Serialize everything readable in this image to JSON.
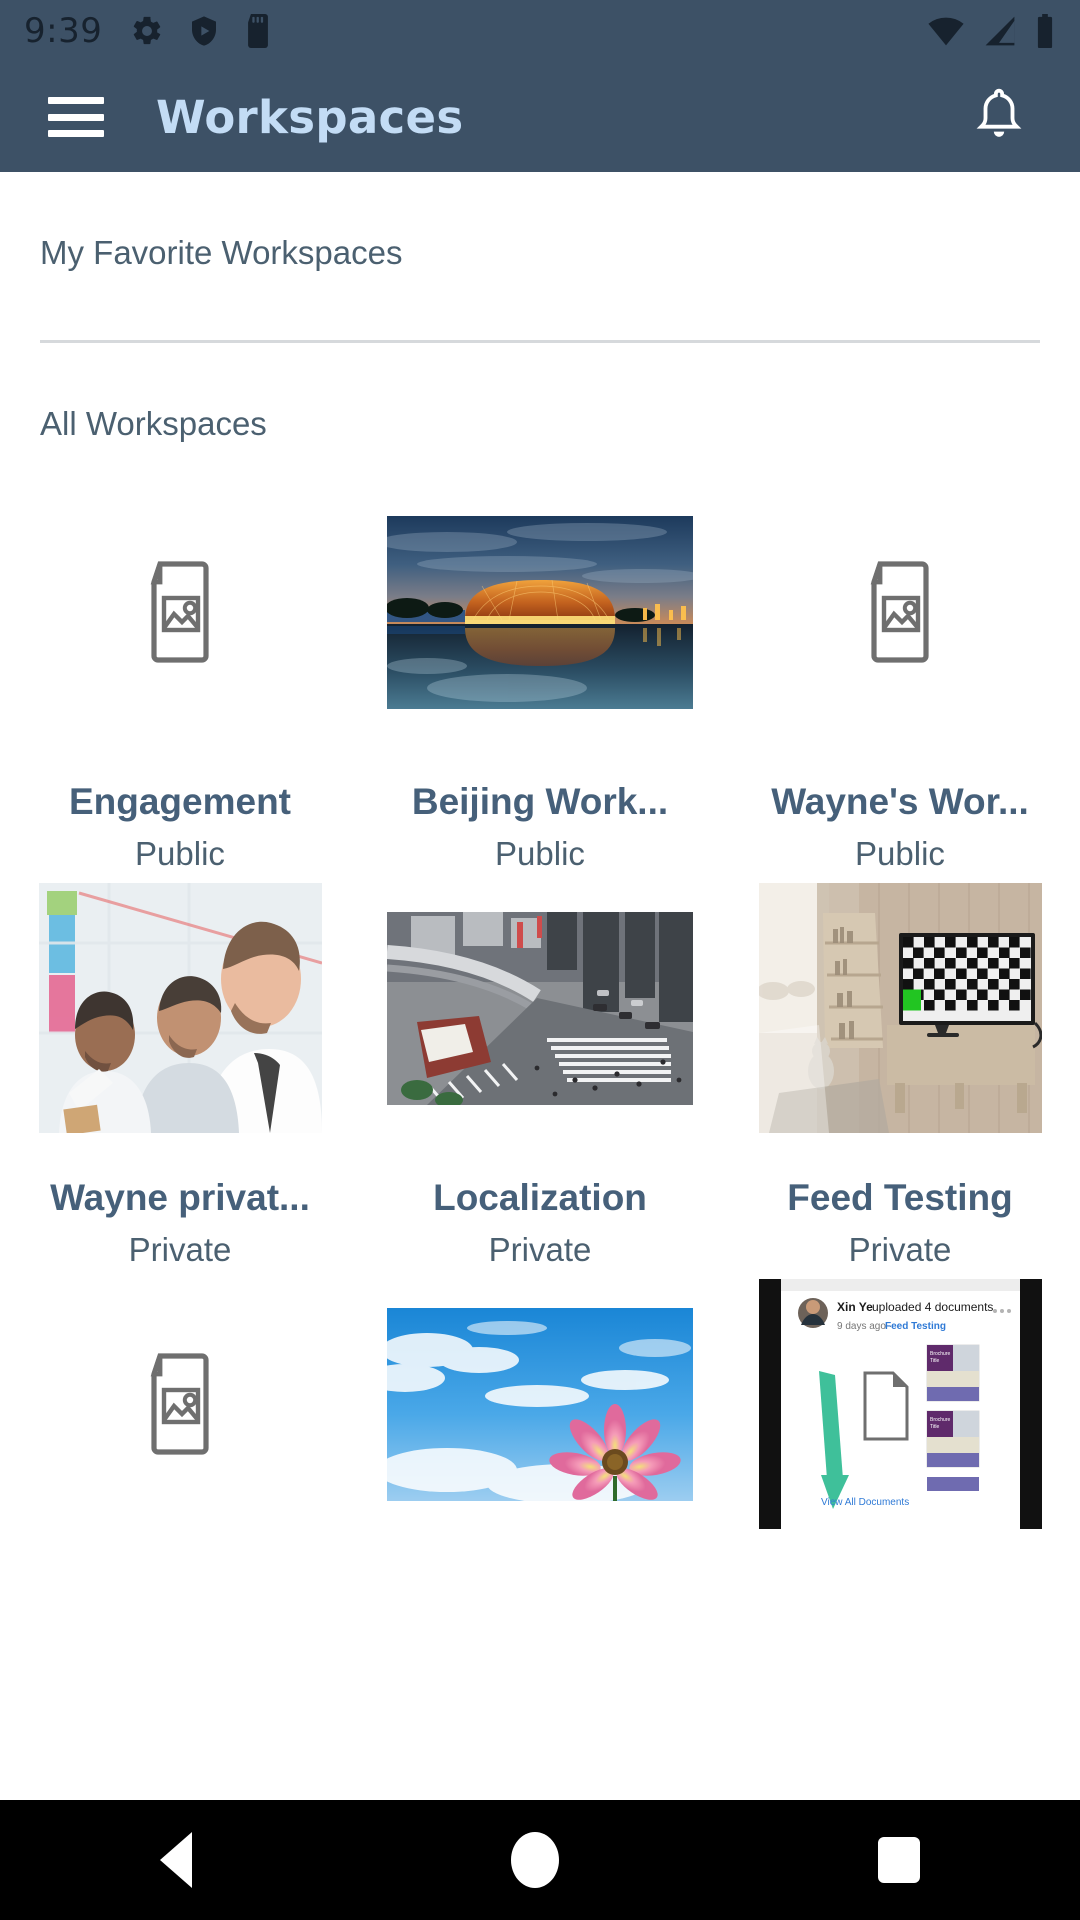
{
  "status_bar": {
    "time": "9:39",
    "left_icons": [
      "gear-icon",
      "play-protect-shield-icon",
      "sd-card-icon"
    ],
    "right_icons": [
      "wifi-icon",
      "cellular-signal-icon",
      "battery-icon"
    ]
  },
  "app_bar": {
    "menu_icon": "hamburger-menu-icon",
    "title": "Workspaces",
    "notification_icon": "bell-icon"
  },
  "sections": {
    "favorites_header": "My Favorite Workspaces",
    "all_header": "All Workspaces"
  },
  "workspaces": [
    {
      "title": "Engagement",
      "visibility": "Public",
      "thumb": "placeholder"
    },
    {
      "title": "Beijing Work...",
      "visibility": "Public",
      "thumb": "beijing-stadium"
    },
    {
      "title": "Wayne's Wor...",
      "visibility": "Public",
      "thumb": "placeholder"
    },
    {
      "title": "Wayne privat...",
      "visibility": "Private",
      "thumb": "business-team"
    },
    {
      "title": "Localization",
      "visibility": "Private",
      "thumb": "city-intersection"
    },
    {
      "title": "Feed Testing",
      "visibility": "Private",
      "thumb": "living-room-tv"
    },
    {
      "title": "",
      "visibility": "",
      "thumb": "placeholder"
    },
    {
      "title": "",
      "visibility": "",
      "thumb": "flower-sky"
    },
    {
      "title": "",
      "visibility": "",
      "thumb": "feed-screenshot"
    }
  ],
  "feed_thumb": {
    "author": "Xin Ye",
    "action": "uploaded 4 documents",
    "meta_time": "9 days ago",
    "meta_sep": "·",
    "meta_workspace": "Feed Testing",
    "view_all": "View All Documents",
    "brochure_title": "Brochure Title"
  },
  "nav_bar": {
    "back": "back-icon",
    "home": "home-icon",
    "recents": "recents-icon"
  },
  "colors": {
    "app_bar": "#3d5166",
    "title": "#c3dcf5",
    "text": "#46607a",
    "divider": "#d6d9dc"
  }
}
